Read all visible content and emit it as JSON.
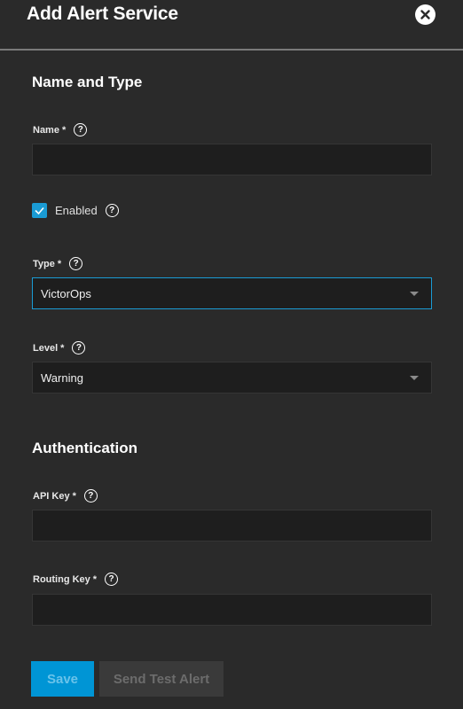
{
  "dialog": {
    "title": "Add Alert Service"
  },
  "sections": {
    "name_type": "Name and Type",
    "authentication": "Authentication"
  },
  "fields": {
    "name": {
      "label": "Name",
      "required": "*",
      "value": ""
    },
    "enabled": {
      "label": "Enabled",
      "checked": true
    },
    "type": {
      "label": "Type",
      "required": "*",
      "value": "VictorOps"
    },
    "level": {
      "label": "Level",
      "required": "*",
      "value": "Warning"
    },
    "api_key": {
      "label": "API Key",
      "required": "*",
      "value": ""
    },
    "routing_key": {
      "label": "Routing Key",
      "required": "*",
      "value": ""
    }
  },
  "help_glyph": "?",
  "buttons": {
    "save": "Save",
    "send_test": "Send Test Alert"
  },
  "colors": {
    "accent": "#1a9bd4",
    "background": "#2a2a2a",
    "input_bg": "#1e1e1e"
  }
}
